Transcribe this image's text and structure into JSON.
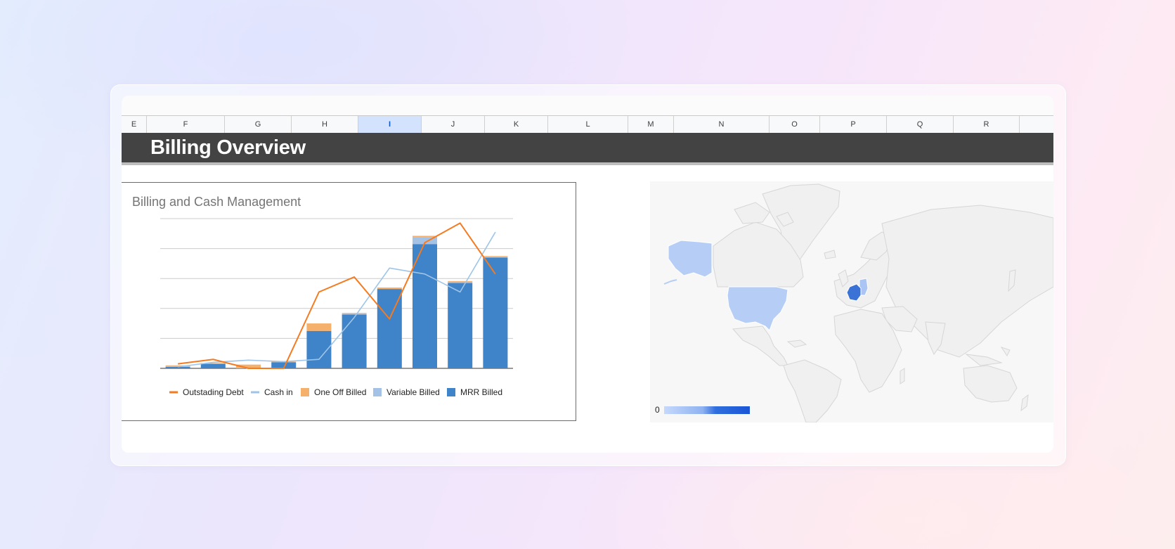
{
  "sheet": {
    "columns": [
      {
        "id": "E",
        "selected": false
      },
      {
        "id": "F",
        "selected": false
      },
      {
        "id": "G",
        "selected": false
      },
      {
        "id": "H",
        "selected": false
      },
      {
        "id": "I",
        "selected": true
      },
      {
        "id": "J",
        "selected": false
      },
      {
        "id": "K",
        "selected": false
      },
      {
        "id": "L",
        "selected": false
      },
      {
        "id": "M",
        "selected": false
      },
      {
        "id": "N",
        "selected": false
      },
      {
        "id": "O",
        "selected": false
      },
      {
        "id": "P",
        "selected": false
      },
      {
        "id": "Q",
        "selected": false
      },
      {
        "id": "R",
        "selected": false
      }
    ],
    "banner_title": "Billing Overview"
  },
  "colors": {
    "mrr": "#3f83c8",
    "variable": "#a4c2e6",
    "one_off": "#f5b06b",
    "outstanding": "#f57b20",
    "cash": "#9ec5e8",
    "banner": "#434343"
  },
  "chart_data": {
    "type": "bar",
    "title": "Billing and Cash Management",
    "xlabel": "",
    "ylabel": "",
    "ylim": [
      0,
      100
    ],
    "grid": true,
    "legend_position": "bottom",
    "categories": [
      "",
      "",
      "",
      "",
      "",
      "",
      "",
      "",
      "",
      ""
    ],
    "series": [
      {
        "name": "MRR Billed",
        "kind": "bar",
        "values": [
          1,
          3,
          0,
          4,
          25,
          36,
          53,
          83,
          57,
          74
        ]
      },
      {
        "name": "Variable Billed",
        "kind": "bar",
        "values": [
          0.5,
          0,
          0,
          0,
          0,
          0.5,
          0,
          4.5,
          0.8,
          0.5
        ]
      },
      {
        "name": "One Off Billed",
        "kind": "bar",
        "values": [
          0.5,
          0.5,
          2.5,
          0.5,
          5,
          0.5,
          1,
          1,
          0.5,
          0.5
        ]
      },
      {
        "name": "Outstading Debt",
        "kind": "line",
        "values": [
          3,
          6,
          0,
          0,
          51,
          61,
          33,
          84,
          97,
          63
        ]
      },
      {
        "name": "Cash in",
        "kind": "line",
        "values": [
          1,
          4,
          5.5,
          4.5,
          6,
          34,
          67,
          63,
          51,
          91
        ]
      }
    ]
  },
  "geo_map": {
    "scale_min_label": "0",
    "highlighted_regions": [
      {
        "region": "France",
        "level": 1.0
      },
      {
        "region": "Germany",
        "level": 0.3
      },
      {
        "region": "United States",
        "level": 0.25
      },
      {
        "region": "Alaska",
        "level": 0.25
      }
    ]
  }
}
